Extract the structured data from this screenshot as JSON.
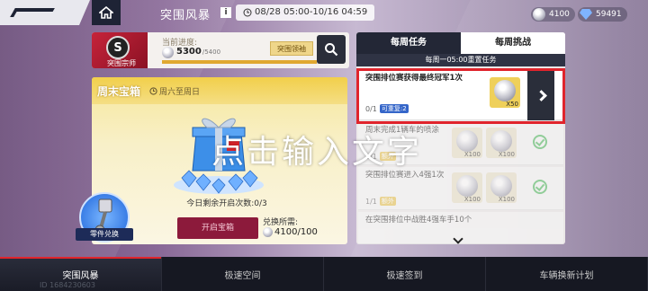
{
  "header": {
    "title": "突围风暴",
    "info_label": "i",
    "time_range": "08/28 05:00-10/16 04:59",
    "currency": {
      "coins": "4100",
      "gems": "59491"
    }
  },
  "rank": {
    "badge_letter": "S",
    "name": "突围宗师",
    "progress_label": "当前进度:",
    "progress_value": "5300",
    "progress_max": "/5400",
    "progress_fraction": 0.98,
    "tag_button": "突围领袖"
  },
  "chest": {
    "title": "周末宝箱",
    "days": "周六至周日",
    "remain_text": "今日剩余开启次数:0/3",
    "open_button": "开启宝箱",
    "cost_label": "兑换所需:",
    "cost_value": "4100/100"
  },
  "parts_exchange": {
    "label": "零件兑换"
  },
  "tasks_panel": {
    "tabs": [
      "每周任务",
      "每周挑战"
    ],
    "active_tab": 0,
    "reset_text": "每周一05:00重置任务",
    "tasks": [
      {
        "title": "突围排位赛获得最终冠军1次",
        "count": "0/1",
        "badge": "可重复:2",
        "reward_qty": "X50",
        "status": "go"
      },
      {
        "title": "周末完成1辆车的喷涂",
        "count": "1/1",
        "badge": "额外",
        "reward_qty": "X100",
        "extra_label": "额外",
        "extra_qty": "X100",
        "status": "done"
      },
      {
        "title": "突围排位赛进入4强1次",
        "count": "1/1",
        "badge": "额外",
        "reward_qty": "X100",
        "extra_label": "额外",
        "extra_qty": "X100",
        "status": "done"
      },
      {
        "title": "在突围排位中战胜4强车手10个",
        "count": "",
        "badge": "",
        "reward_qty": "",
        "status": "partial"
      }
    ]
  },
  "overlay_text": "点击输入文字",
  "bottom_nav": {
    "items": [
      "突围风暴",
      "极速空间",
      "极速签到",
      "车辆换新计划"
    ],
    "active": 0
  },
  "uid": "ID 1684230603",
  "colors": {
    "accent_red": "#e0242c",
    "button_dark": "#2a2e3a",
    "chest_yellow": "#f2cf4a"
  }
}
